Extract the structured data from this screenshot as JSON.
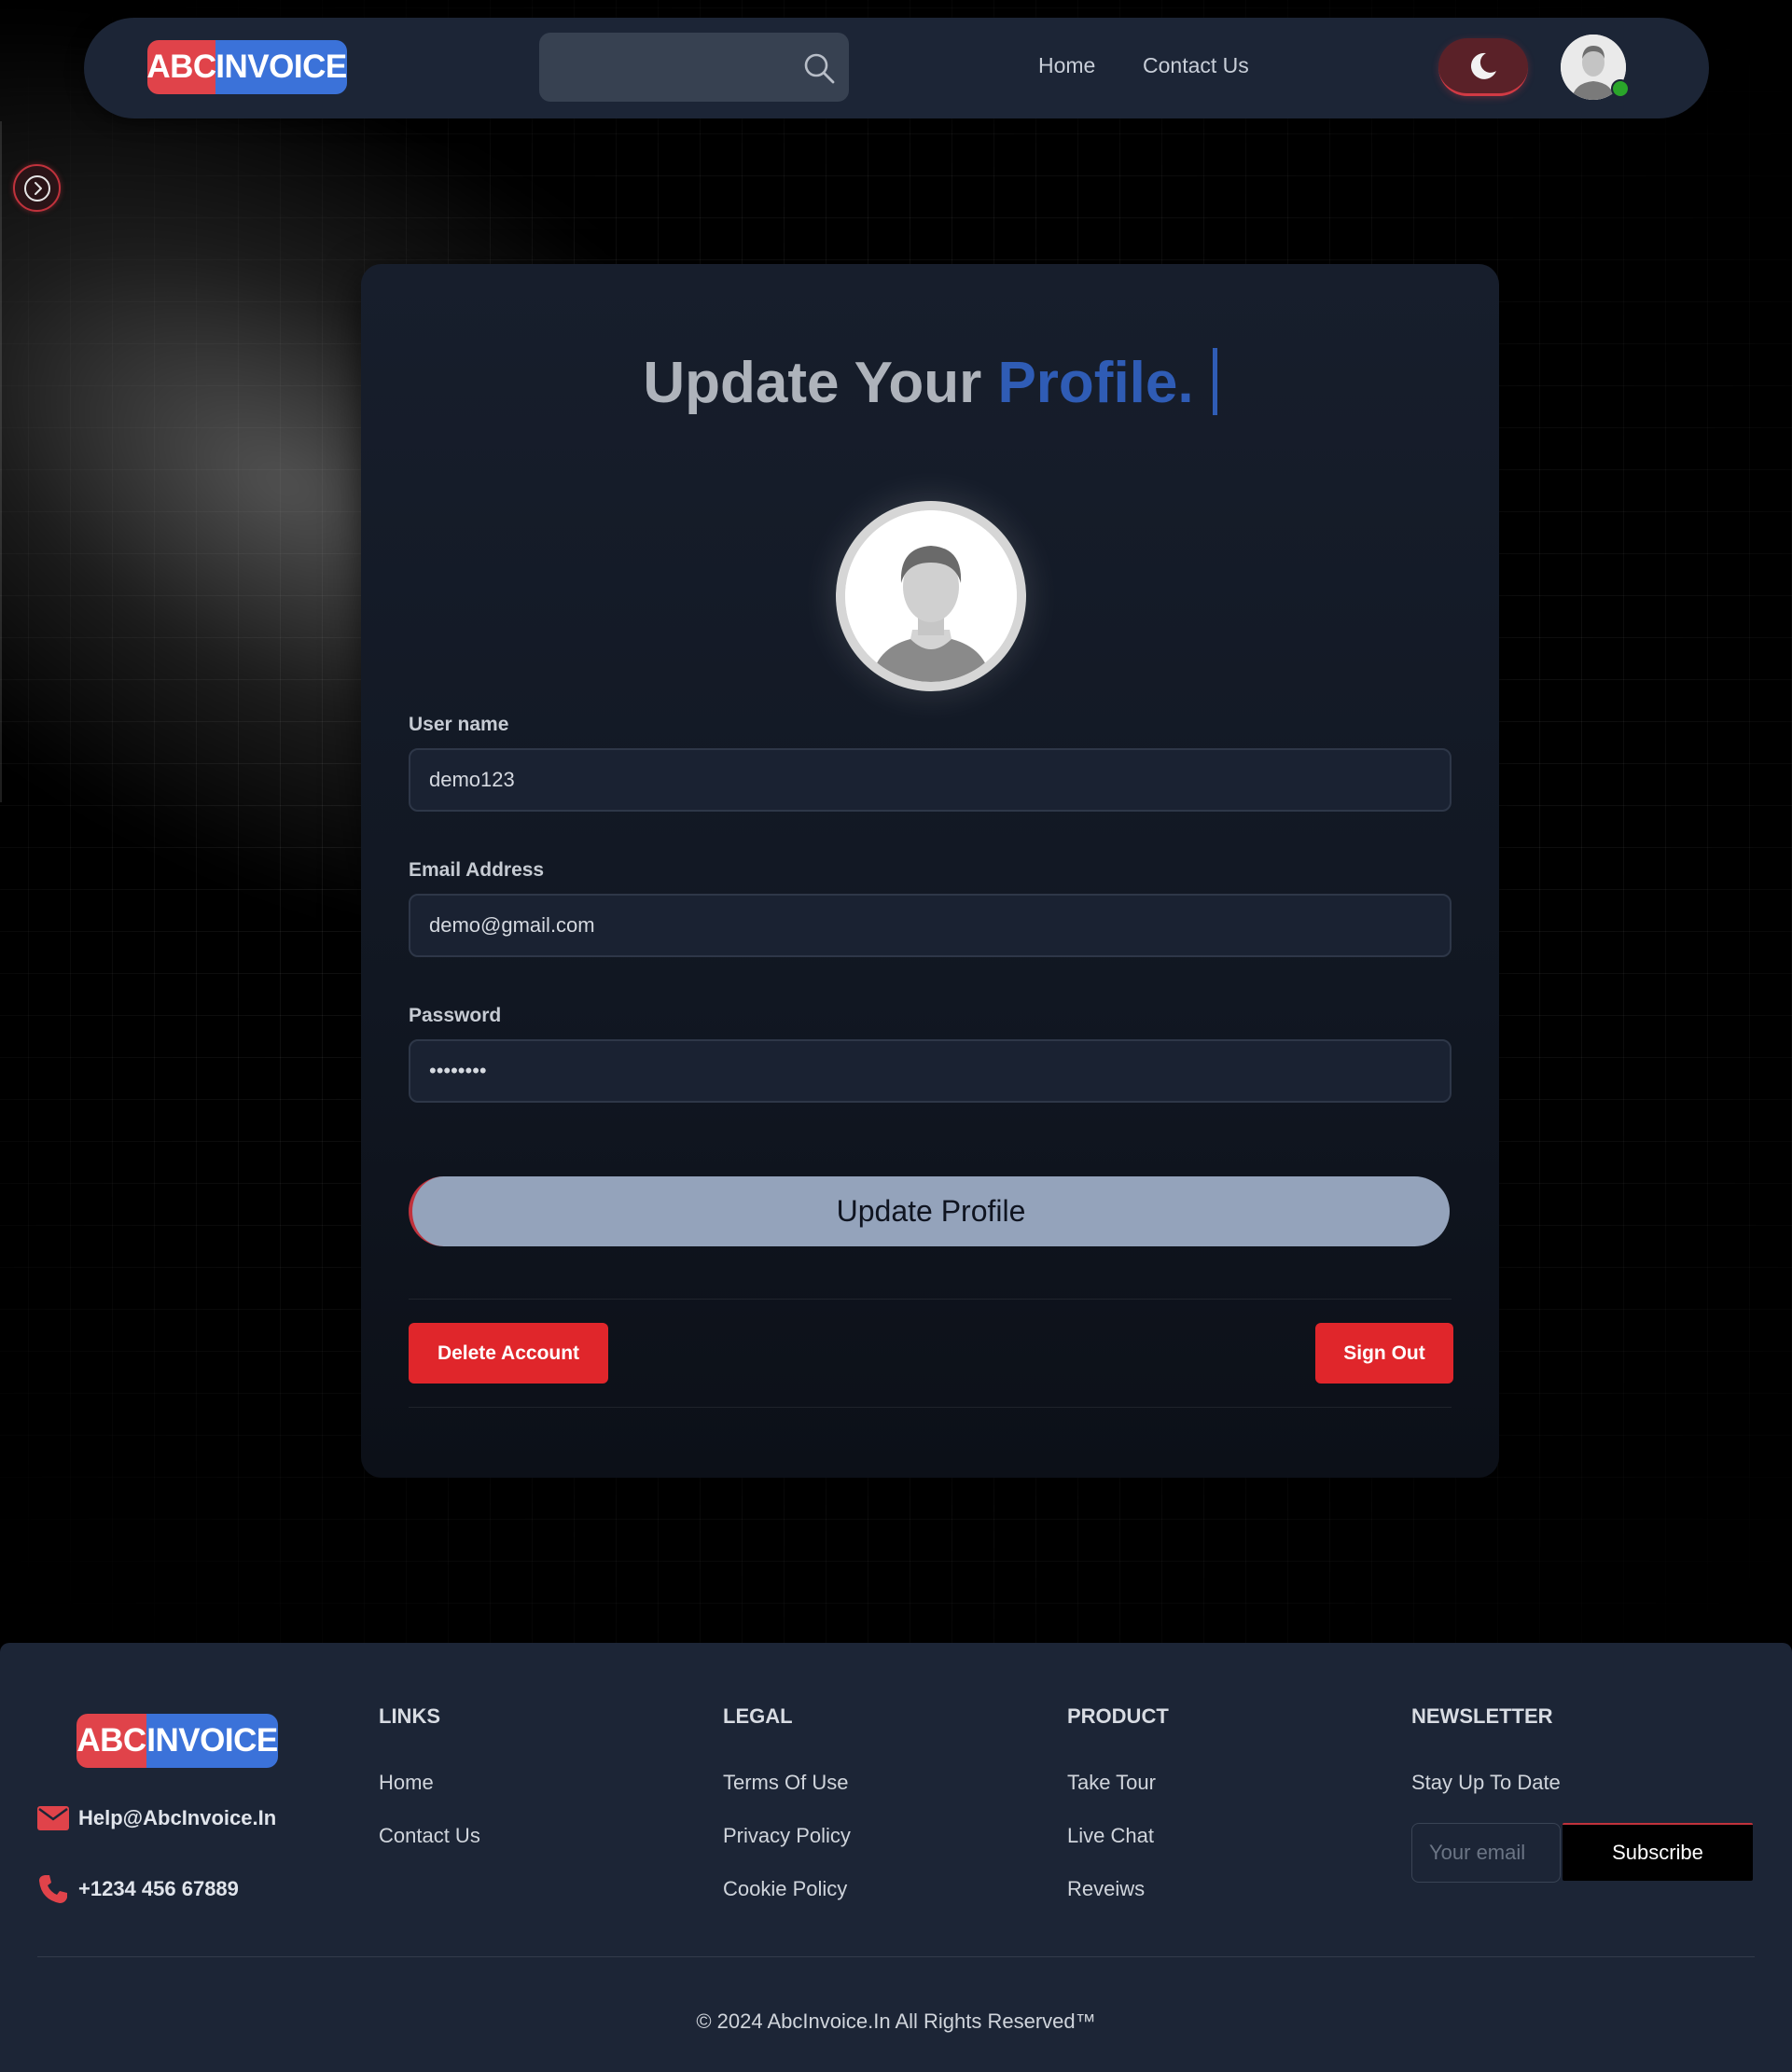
{
  "colors": {
    "brand_red": "#e0434a",
    "brand_blue": "#3b72d9",
    "accent_blue": "#2f5cb5",
    "danger": "#e0262b",
    "navbar_bg": "#1c2536",
    "online": "#2aa52a"
  },
  "brand": {
    "part1": "ABC",
    "part2": "INVOICE"
  },
  "navbar": {
    "search_placeholder": "",
    "search_icon": "search-icon",
    "links": [
      "Home",
      "Contact Us"
    ],
    "theme_icon": "moon-icon",
    "avatar_icon": "user-avatar",
    "online_status": "online"
  },
  "sidebar": {
    "toggle_icon": "chevron-right-icon"
  },
  "profile": {
    "title_main": "Update Your",
    "title_accent": "Profile.",
    "fields": {
      "username_label": "User name",
      "username_value": "demo123",
      "email_label": "Email Address",
      "email_value": "demo@gmail.com",
      "password_label": "Password",
      "password_value": "........"
    },
    "update_button": "Update Profile",
    "delete_button": "Delete Account",
    "signout_button": "Sign Out"
  },
  "footer": {
    "email": "Help@AbcInvoice.In",
    "phone": "+1234 456 67889",
    "links_heading": "LINKS",
    "links": [
      "Home",
      "Contact Us"
    ],
    "legal_heading": "LEGAL",
    "legal": [
      "Terms Of Use",
      "Privacy Policy",
      "Cookie Policy"
    ],
    "product_heading": "PRODUCT",
    "product": [
      "Take Tour",
      "Live Chat",
      "Reveiws"
    ],
    "newsletter_heading": "NEWSLETTER",
    "newsletter_sub": "Stay Up To Date",
    "newsletter_placeholder": "Your email",
    "newsletter_button": "Subscribe",
    "copyright": "© 2024 AbcInvoice.In All Rights Reserved™"
  }
}
